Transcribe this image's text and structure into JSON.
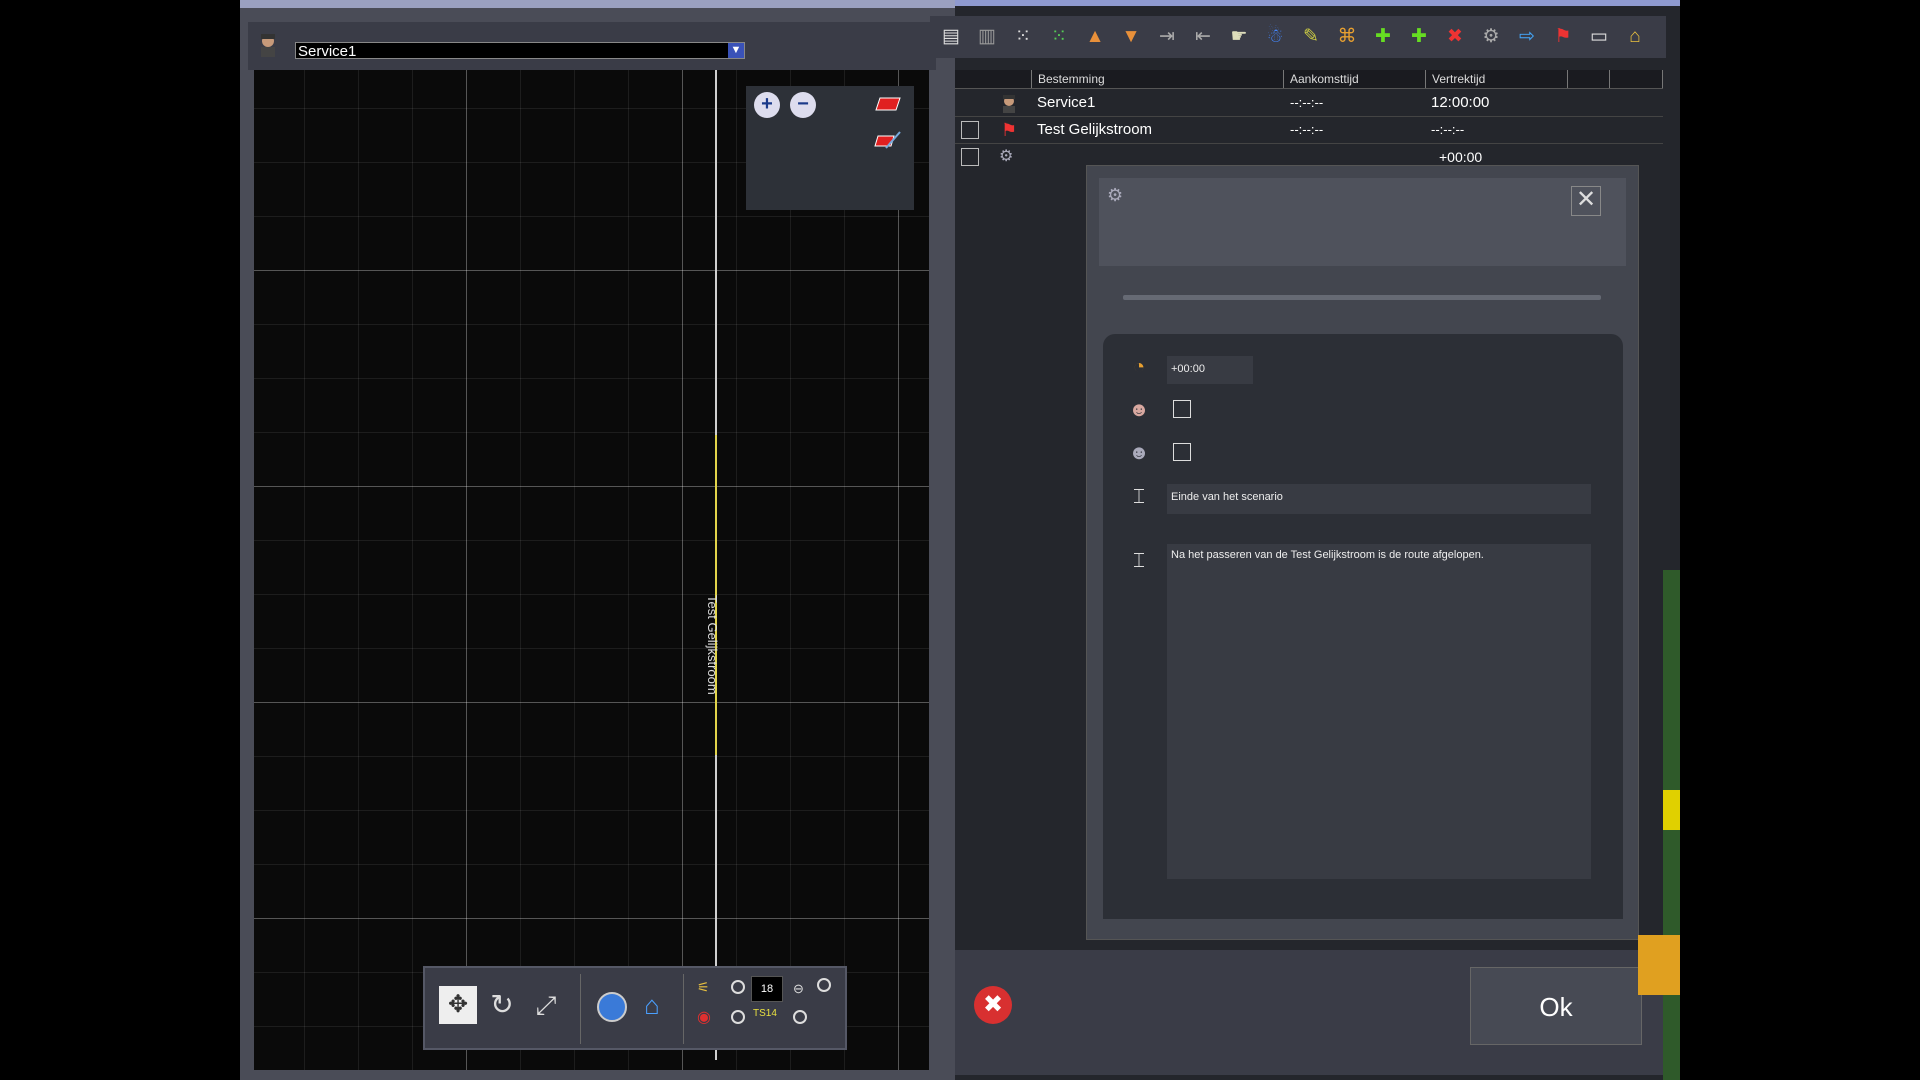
{
  "left_panel": {
    "service_value": "Service1",
    "track_label": "Test Gelijkstroom",
    "zoom_in_icon": "zoom-in-icon",
    "zoom_out_icon": "zoom-out-icon",
    "toolbar_digits": "18",
    "toolbar_label": "TS14"
  },
  "schedule_table": {
    "headers": [
      "Bestemming",
      "Aankomsttijd",
      "Vertrektijd"
    ],
    "rows": [
      {
        "destination": "Service1",
        "arrival": "--:--:--",
        "departure": "12:00:00"
      },
      {
        "destination": "Test Gelijkstroom",
        "arrival": "--:--:--",
        "departure": "--:--:--"
      },
      {
        "destination": "",
        "arrival": "",
        "departure": "+00:00"
      }
    ]
  },
  "dialog": {
    "time_offset": "+00:00",
    "title_field": "Einde van het scenario",
    "description_field": "Na het passeren van de Test Gelijkstroom is de route afgelopen."
  },
  "bottom_bar": {
    "ok_label": "Ok"
  },
  "colors": {
    "accent_blue": "#3a52b8",
    "track_yellow": "#e2d44a",
    "panel_dark": "#24262c"
  }
}
